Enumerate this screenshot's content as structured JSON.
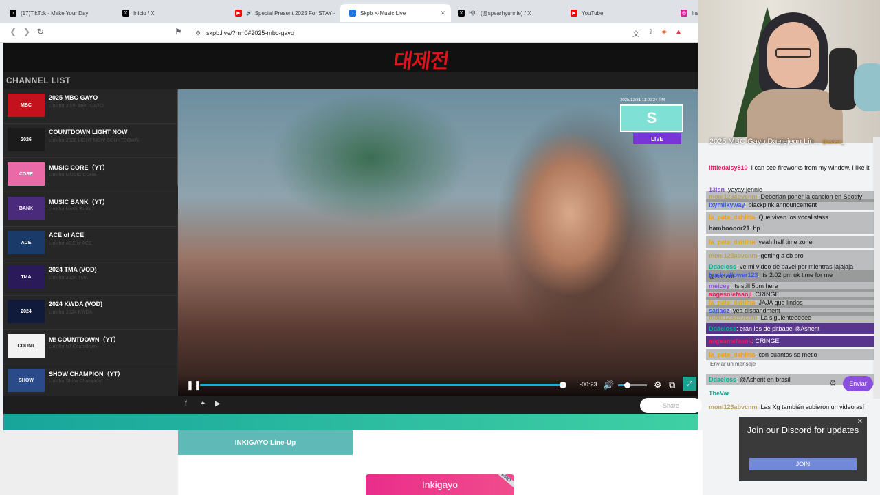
{
  "browser": {
    "tabs": [
      {
        "label": "(17)TikTok - Make Your Day",
        "color": "#000000"
      },
      {
        "label": "Inicio / X",
        "color": "#000000"
      },
      {
        "label": "Special Present 2025 For STAY -",
        "color": "#ff0000"
      },
      {
        "label": "Skpb K-Music Live",
        "color": "#1a73e8"
      },
      {
        "label": "비니 (@spearhyunnie) / X",
        "color": "#000000"
      },
      {
        "label": "YouTube",
        "color": "#ff0000"
      },
      {
        "label": "Ins",
        "color": "#d6249f"
      }
    ],
    "url": "skpb.live/?m=0#2025-mbc-gayo"
  },
  "site": {
    "channel_list_title": "CHANNEL LIST",
    "channels": [
      {
        "name": "2025 MBC GAYO",
        "sub": "Link for 2025 MBC GAYO",
        "thumb_text": "MBC",
        "thumb_color": "#c3121b"
      },
      {
        "name": "COUNTDOWN LIGHT NOW",
        "sub": "Link for 2026 LIGHT NOW COUNTDOWN",
        "thumb_text": "2026",
        "thumb_color": "#1b1b1b"
      },
      {
        "name": "MUSIC CORE（YT）",
        "sub": "Link for MUSIC CORE",
        "thumb_text": "CORE",
        "thumb_color": "#e96aa6"
      },
      {
        "name": "MUSIC BANK（YT）",
        "sub": "Link for Music Bank",
        "thumb_text": "BANK",
        "thumb_color": "#4a2a7a"
      },
      {
        "name": "ACE of ACE",
        "sub": "Link for ACE of ACE",
        "thumb_text": "ACE",
        "thumb_color": "#1a3a6a"
      },
      {
        "name": "2024 TMA (VOD)",
        "sub": "Link for 2024 TMA",
        "thumb_text": "TMA",
        "thumb_color": "#2a1a5a"
      },
      {
        "name": "2024 KWDA (VOD)",
        "sub": "Link for 2024 KWDA",
        "thumb_text": "2024",
        "thumb_color": "#101a3a"
      },
      {
        "name": "M! COUNTDOWN（YT）",
        "sub": "Link for M! Countdown",
        "thumb_text": "COUNT",
        "thumb_color": "#f2f2f2"
      },
      {
        "name": "SHOW CHAMPION（YT）",
        "sub": "Link for Show Champion",
        "thumb_text": "SHOW",
        "thumb_color": "#2a4a8a"
      }
    ],
    "player": {
      "overlay_timestamp": "2025/12/31 11:02:24 PM",
      "overlay_live": "LIVE",
      "time_remaining": "-00:23",
      "progress": 0.98,
      "volume": 0.3
    },
    "share_label": "Share",
    "lineup_label": "INKIGAYO Line-Up",
    "inkigayo_label": "Inkigayo",
    "demo_label": "DEMO"
  },
  "chat": {
    "header": "2025 MBC Gayo Daejejeon Lin...",
    "header_user": "@asherit_",
    "messages": [
      {
        "user": "littledaisy810",
        "text": "I can see fireworks from my window, i like it",
        "color": "#e0245e"
      },
      {
        "user": "13isn",
        "text": "yayay jennie",
        "color": "#8a4fd0"
      },
      {
        "user": "moni123abvcnm",
        "text": "Deberian poner la cancion en Spotify",
        "color": "#b8a060"
      },
      {
        "user": "ixymilkyway",
        "text": "blackpink announcement",
        "color": "#3b5bdb"
      },
      {
        "user": "la_pata_dahlitia",
        "text": "Que vivan los vocalistass",
        "color": "#e8a020"
      },
      {
        "user": "hamboooor21",
        "text": "bp",
        "color": "#333333"
      },
      {
        "user": "la_pata_dahlitia",
        "text": "yeah half time zone",
        "color": "#e8a020"
      },
      {
        "user": "moni123abvcnm",
        "text": "getting a cb bro",
        "color": "#b8a060"
      },
      {
        "user": "Ddaeloss",
        "text": "ve mi video de pavel por mientras jajajaja @Asherit",
        "color": "#1aa391"
      },
      {
        "user": "bushraflower123",
        "text": "its 2:02 pm uk time for me",
        "color": "#3b5bdb"
      },
      {
        "user": "meicey",
        "text": "its still 5pm here",
        "color": "#8a4fd0"
      },
      {
        "user": "angesniefaanji",
        "text": "CRINGE",
        "color": "#e0245e"
      },
      {
        "user": "la_pata_dahlitia",
        "text": "JAJA que lindos",
        "color": "#e8a020"
      },
      {
        "user": "sadacz",
        "text": "yea disbandment",
        "color": "#3b5bdb"
      },
      {
        "user": "moni123abvcnm",
        "text": "La siguienteeeeee",
        "color": "#b8a060"
      },
      {
        "user": "Ddaeloss",
        "text": "eran los de pitbabe @Asherit",
        "color": "#1aa391"
      },
      {
        "user": "angesniefaanji",
        "text": "CRINGE",
        "color": "#e0245e"
      },
      {
        "user": "la_pata_dahlitia",
        "text": "con cuantos se metio",
        "color": "#e8a020"
      },
      {
        "user": "Ddaeloss",
        "text": "@Asherit en brasil",
        "color": "#1aa391"
      },
      {
        "user": "TheVar",
        "text": "",
        "color": "#1aa391"
      },
      {
        "user": "moni123abvcnm",
        "text": "Las Xg también subieron un video así",
        "color": "#b8a060"
      }
    ],
    "input_placeholder": "Enviar un mensaje",
    "send_label": "Enviar"
  },
  "discord": {
    "title": "Join our Discord for updates",
    "join_label": "JOIN"
  }
}
